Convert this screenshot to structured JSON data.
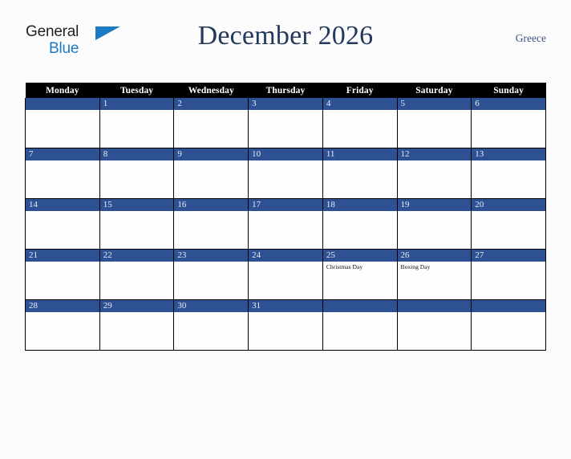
{
  "brand": {
    "name_part1": "General",
    "name_part2": "Blue",
    "triangle_icon": "triangle-icon",
    "colors": {
      "dark": "#231f20",
      "blue": "#1a7bc4"
    }
  },
  "header": {
    "title": "December 2026",
    "country": "Greece",
    "title_color": "#23395d"
  },
  "calendar": {
    "accent_color": "#2e5193",
    "header_bg": "#000000",
    "weekday_headers": [
      "Monday",
      "Tuesday",
      "Wednesday",
      "Thursday",
      "Friday",
      "Saturday",
      "Sunday"
    ],
    "weeks": [
      [
        {
          "day": "",
          "events": []
        },
        {
          "day": "1",
          "events": []
        },
        {
          "day": "2",
          "events": []
        },
        {
          "day": "3",
          "events": []
        },
        {
          "day": "4",
          "events": []
        },
        {
          "day": "5",
          "events": []
        },
        {
          "day": "6",
          "events": []
        }
      ],
      [
        {
          "day": "7",
          "events": []
        },
        {
          "day": "8",
          "events": []
        },
        {
          "day": "9",
          "events": []
        },
        {
          "day": "10",
          "events": []
        },
        {
          "day": "11",
          "events": []
        },
        {
          "day": "12",
          "events": []
        },
        {
          "day": "13",
          "events": []
        }
      ],
      [
        {
          "day": "14",
          "events": []
        },
        {
          "day": "15",
          "events": []
        },
        {
          "day": "16",
          "events": []
        },
        {
          "day": "17",
          "events": []
        },
        {
          "day": "18",
          "events": []
        },
        {
          "day": "19",
          "events": []
        },
        {
          "day": "20",
          "events": []
        }
      ],
      [
        {
          "day": "21",
          "events": []
        },
        {
          "day": "22",
          "events": []
        },
        {
          "day": "23",
          "events": []
        },
        {
          "day": "24",
          "events": []
        },
        {
          "day": "25",
          "events": [
            "Christmas Day"
          ]
        },
        {
          "day": "26",
          "events": [
            "Boxing Day"
          ]
        },
        {
          "day": "27",
          "events": []
        }
      ],
      [
        {
          "day": "28",
          "events": []
        },
        {
          "day": "29",
          "events": []
        },
        {
          "day": "30",
          "events": []
        },
        {
          "day": "31",
          "events": []
        },
        {
          "day": "",
          "events": []
        },
        {
          "day": "",
          "events": []
        },
        {
          "day": "",
          "events": []
        }
      ]
    ]
  }
}
